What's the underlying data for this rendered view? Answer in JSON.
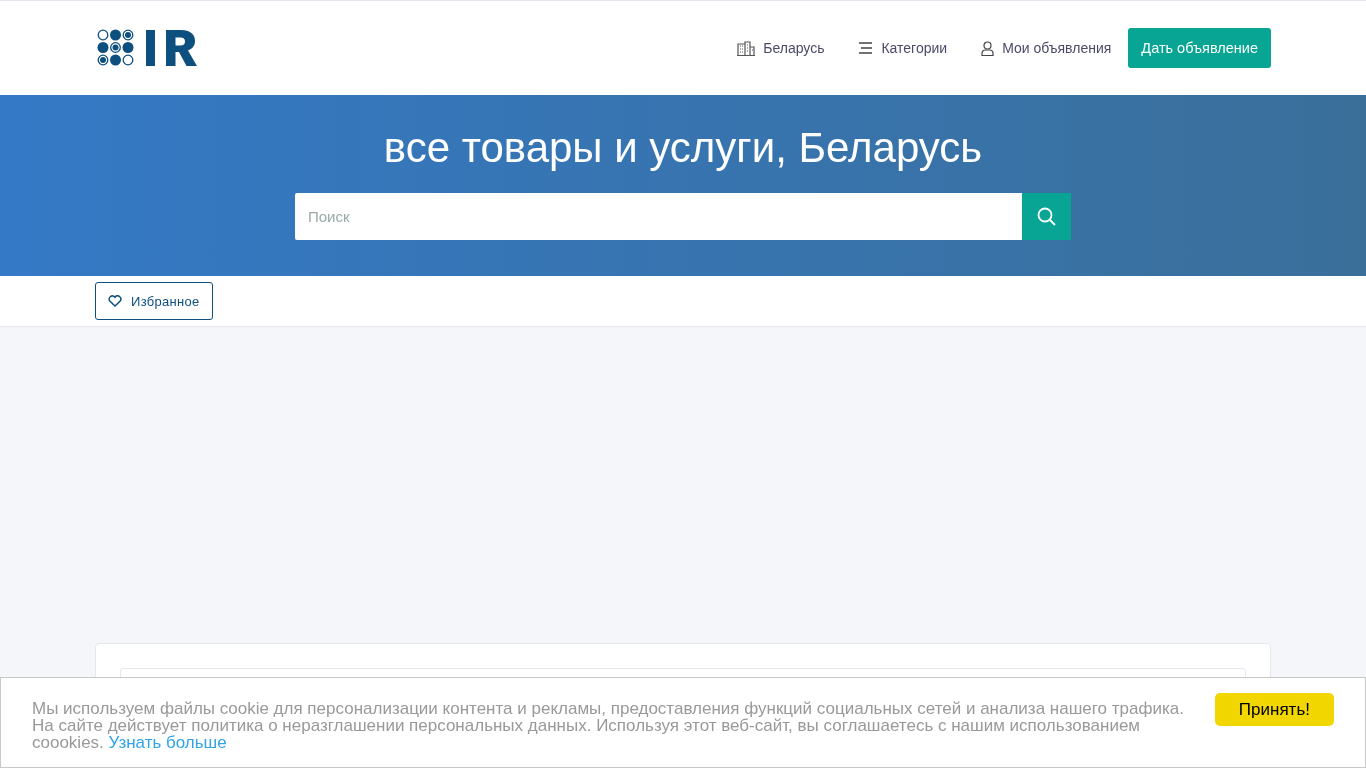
{
  "header": {
    "nav": [
      {
        "kind": "region",
        "label": "Беларусь"
      },
      {
        "kind": "categories",
        "label": "Категории"
      },
      {
        "kind": "account",
        "label": "Мои объявления"
      }
    ],
    "post_button": "Дать объявление"
  },
  "hero": {
    "title": "все товары и услуги, Беларусь",
    "search": {
      "placeholder": "Поиск"
    }
  },
  "favorites_button": "Избранное",
  "cookie_banner": {
    "text": "Мы используем файлы cookie для персонализации контента и рекламы, предоставления функций социальных сетей и анализа нашего трафика. На сайте действует политика о неразглашении персональных данных. Используя этот веб-сайт, вы соглашаетесь с нашим использованием coookies.",
    "link": "Узнать больше",
    "accept_button": "Принять!"
  }
}
